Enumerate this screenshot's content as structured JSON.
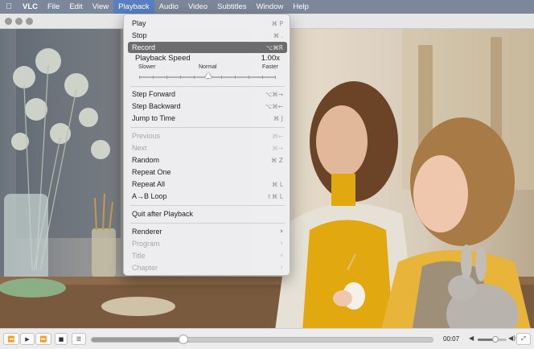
{
  "menubar": {
    "apple_icon": "apple-icon",
    "items": [
      {
        "label": "VLC",
        "bold": true
      },
      {
        "label": "File"
      },
      {
        "label": "Edit"
      },
      {
        "label": "View"
      },
      {
        "label": "Playback",
        "active": true
      },
      {
        "label": "Audio"
      },
      {
        "label": "Video"
      },
      {
        "label": "Subtitles"
      },
      {
        "label": "Window"
      },
      {
        "label": "Help"
      }
    ]
  },
  "playback_menu": {
    "items": [
      {
        "label": "Play",
        "shortcut": "⌘ P",
        "state": "normal"
      },
      {
        "label": "Stop",
        "shortcut": "⌘ .",
        "state": "normal"
      },
      {
        "label": "Record",
        "shortcut": "⌥⌘R",
        "state": "highlighted"
      }
    ],
    "speed": {
      "title": "Playback Speed",
      "value": "1.00x",
      "slower": "Slower",
      "normal": "Normal",
      "faster": "Faster",
      "position_fraction": 0.5
    },
    "step_items": [
      {
        "label": "Step Forward",
        "shortcut": "⌥⌘→",
        "state": "normal"
      },
      {
        "label": "Step Backward",
        "shortcut": "⌥⌘←",
        "state": "normal"
      },
      {
        "label": "Jump to Time",
        "shortcut": "⌘ J",
        "state": "normal"
      }
    ],
    "playlist_items": [
      {
        "label": "Previous",
        "shortcut": "⌘←",
        "state": "disabled"
      },
      {
        "label": "Next",
        "shortcut": "⌘→",
        "state": "disabled"
      },
      {
        "label": "Random",
        "shortcut": "⌘ Z",
        "state": "normal"
      },
      {
        "label": "Repeat One",
        "shortcut": "",
        "state": "normal"
      },
      {
        "label": "Repeat All",
        "shortcut": "⌘ L",
        "state": "normal"
      },
      {
        "label": "A→B Loop",
        "shortcut": "⇧⌘ L",
        "state": "normal"
      }
    ],
    "quit_item": {
      "label": "Quit after Playback",
      "state": "normal"
    },
    "submenu_items": [
      {
        "label": "Renderer",
        "state": "normal"
      },
      {
        "label": "Program",
        "state": "disabled"
      },
      {
        "label": "Title",
        "state": "disabled"
      },
      {
        "label": "Chapter",
        "state": "disabled"
      }
    ]
  },
  "controls": {
    "rewind_icon": "⏪",
    "play_icon": "▶",
    "forward_icon": "⏩",
    "stop_icon": "■",
    "playlist_icon": "☰",
    "time": "00:07",
    "progress_fraction": 0.27,
    "volume_fraction": 0.6,
    "volume_low_icon": "◀",
    "volume_high_icon": "◀)",
    "fullscreen_icon": "⤢"
  },
  "colors": {
    "menubar_bg": "#7c8899",
    "menu_highlight": "#6c6c6c",
    "active_menubar_item": "#5a7fc0"
  }
}
